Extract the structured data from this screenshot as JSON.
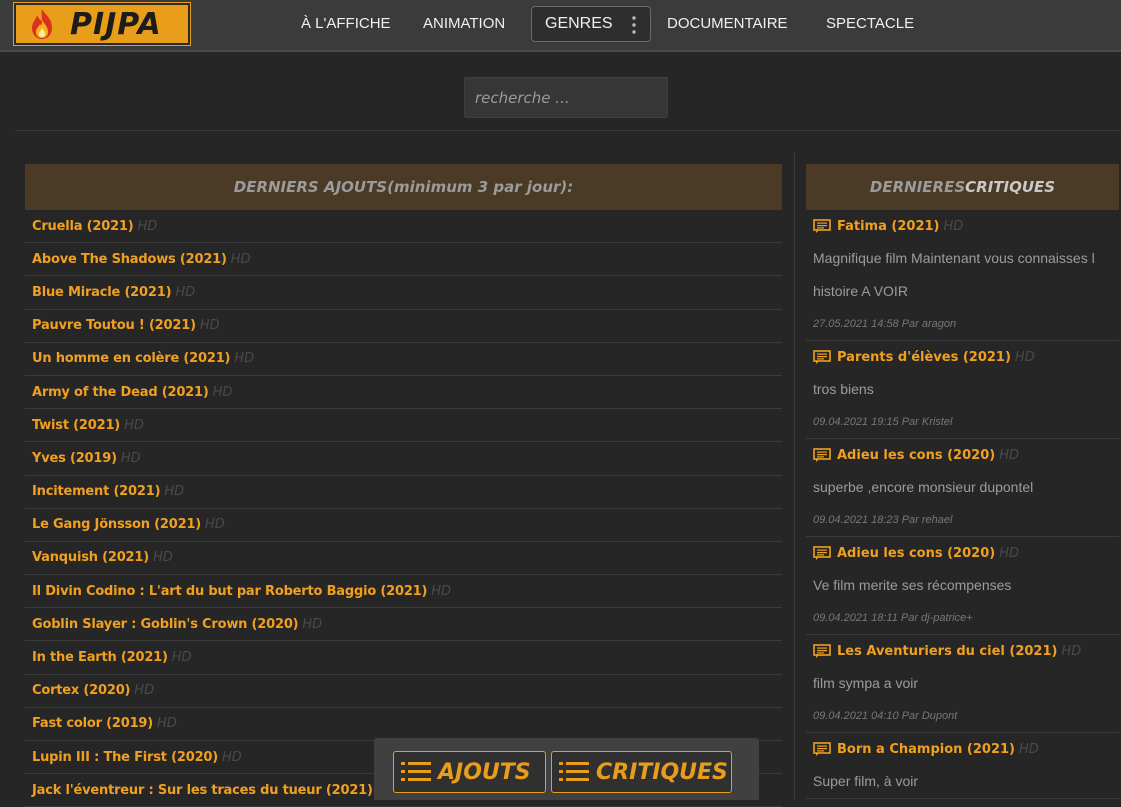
{
  "header": {
    "logo_text": "PIJPA",
    "nav": [
      {
        "label": "À L'AFFICHE"
      },
      {
        "label": "ANIMATION"
      },
      {
        "label": "GENRES"
      },
      {
        "label": "DOCUMENTAIRE"
      },
      {
        "label": "SPECTACLE"
      }
    ]
  },
  "search": {
    "placeholder": "recherche ..."
  },
  "ajouts": {
    "title_a": "DERNIERS AJOUTS",
    "title_b": " (minimum 3 par jour):",
    "quality": "HD",
    "items": [
      "Cruella (2021)",
      "Above The Shadows (2021)",
      "Blue Miracle (2021)",
      "Pauvre Toutou ! (2021)",
      "Un homme en colère (2021)",
      "Army of the Dead (2021)",
      "Twist (2021)",
      "Yves (2019)",
      "Incitement (2021)",
      "Le Gang Jönsson (2021)",
      "Vanquish (2021)",
      "Il Divin Codino : L'art du but par Roberto Baggio (2021)",
      "Goblin Slayer : Goblin's Crown (2020)",
      "In the Earth (2021)",
      "Cortex (2020)",
      "Fast color (2019)",
      "Lupin III : The First (2020)",
      "Jack l'éventreur : Sur les traces du tueur (2021)"
    ]
  },
  "critiques": {
    "title_a": "DERNIERES ",
    "title_b": "CRITIQUES",
    "quality": "HD",
    "items": [
      {
        "title": "Fatima (2021)",
        "text": "Magnifique film Maintenant vous connaisses l histoire A VOIR",
        "meta": "27.05.2021 14:58 Par aragon"
      },
      {
        "title": "Parents d'élèves (2021)",
        "text": "tros biens",
        "meta": "09.04.2021 19:15 Par Kristel"
      },
      {
        "title": "Adieu les cons (2020)",
        "text": "superbe ,encore monsieur dupontel",
        "meta": "09.04.2021 18:23 Par rehael"
      },
      {
        "title": "Adieu les cons (2020)",
        "text": "Ve film merite ses récompenses",
        "meta": "09.04.2021 18:11 Par dj-patrice+"
      },
      {
        "title": "Les Aventuriers du ciel (2021)",
        "text": "film sympa a voir",
        "meta": "09.04.2021 04:10 Par Dupont"
      },
      {
        "title": "Born a Champion (2021)",
        "text": "Super film, à voir",
        "meta": ""
      }
    ]
  },
  "float_bar": {
    "ajouts_label": "AJOUTS",
    "critiques_label": "CRITIQUES"
  },
  "colors": {
    "accent": "#f0a020",
    "header_bg": "#3b3b3b",
    "section_head_bg": "#4a3a26"
  }
}
